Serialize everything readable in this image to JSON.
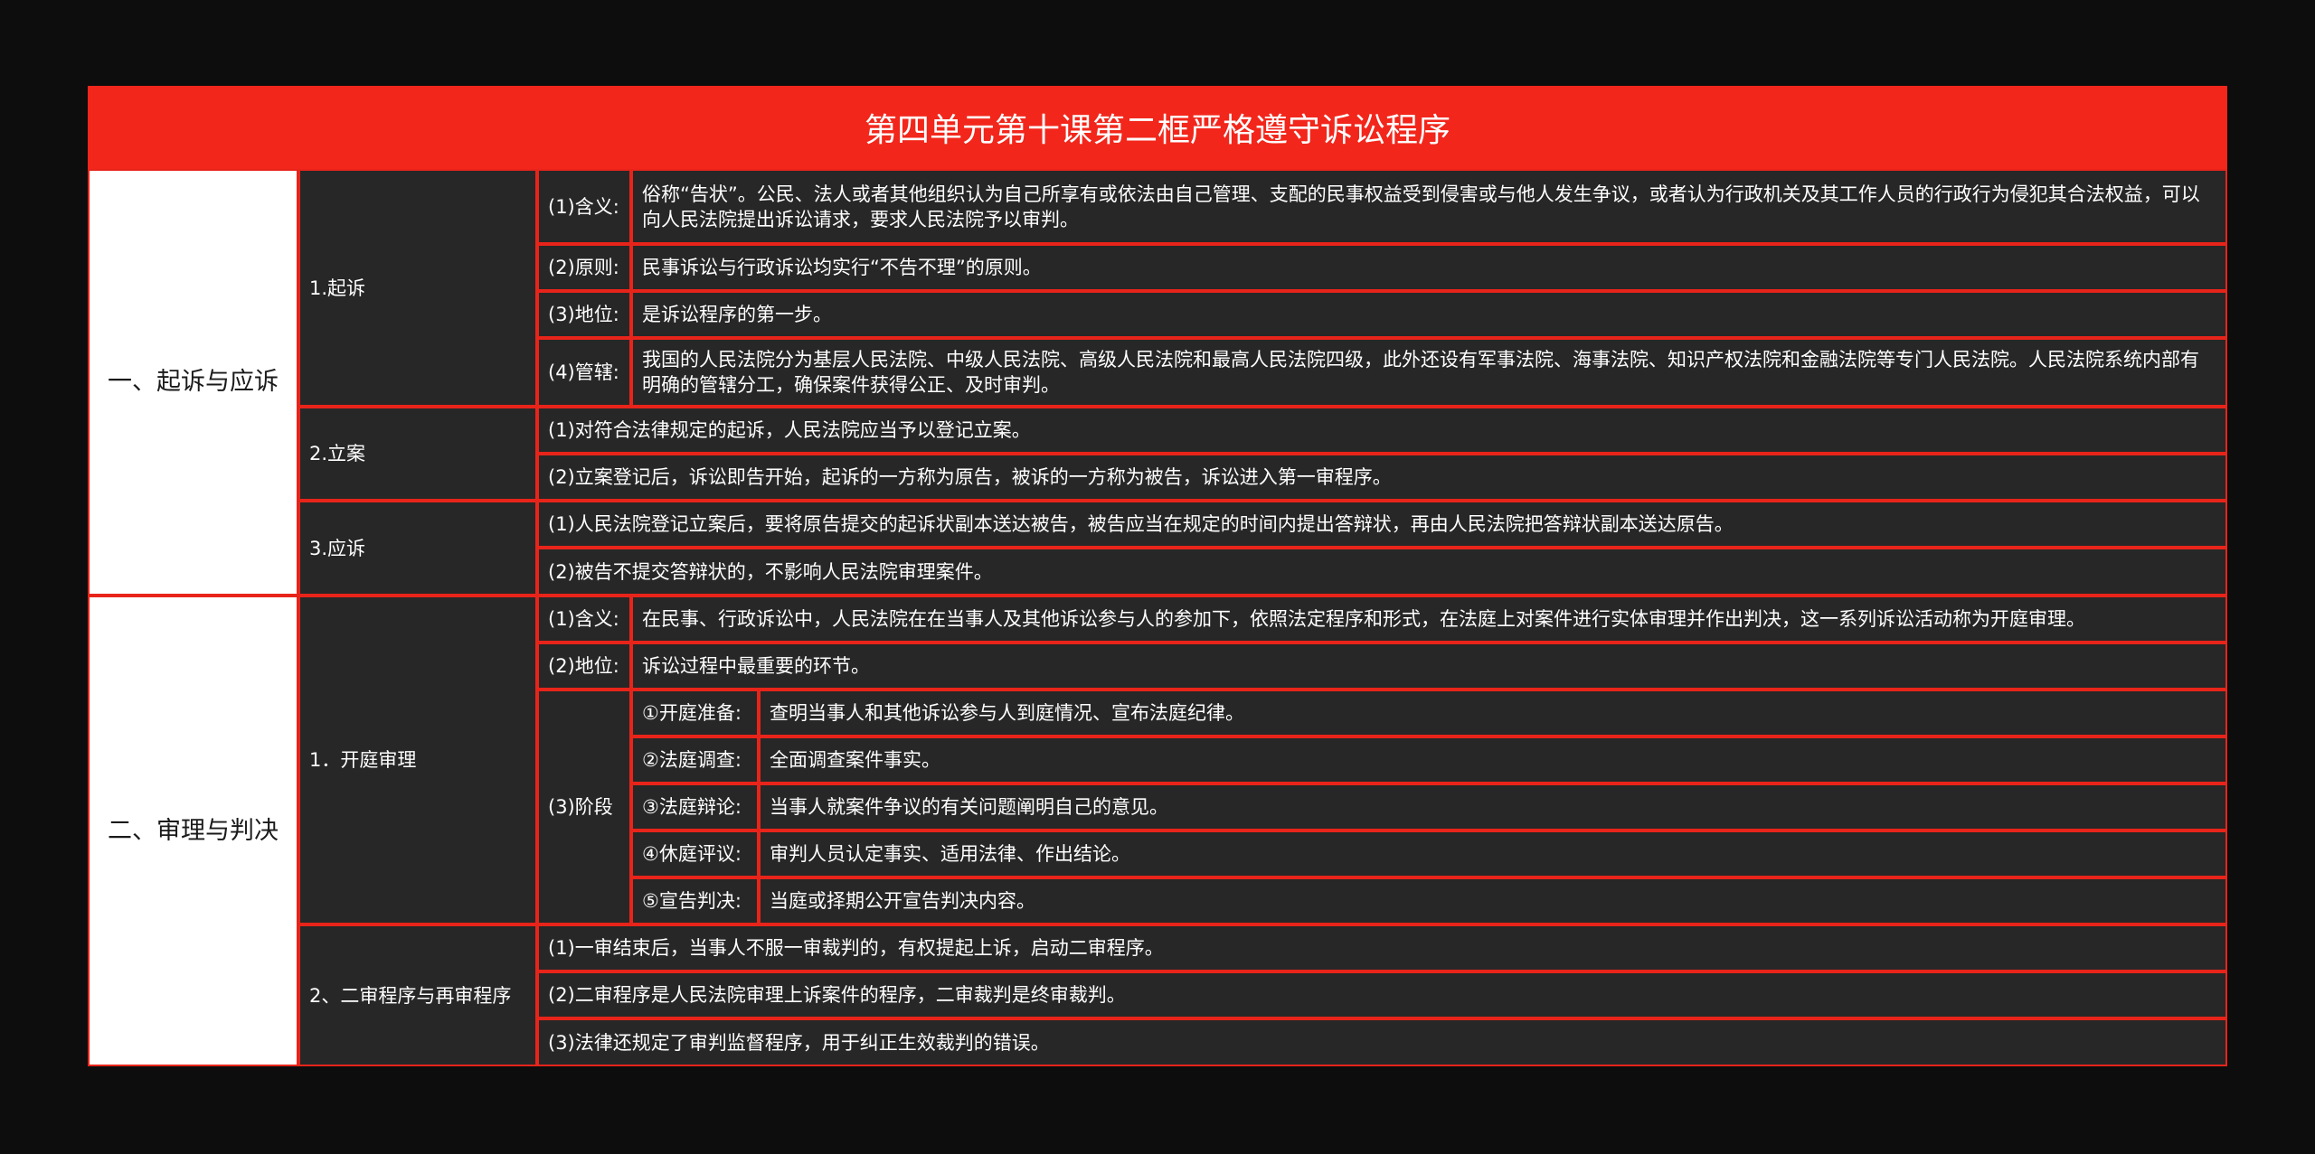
{
  "title": "第四单元第十课第二框严格遵守诉讼程序",
  "sections": [
    {
      "label": "一、起诉与应诉",
      "groups": [
        {
          "label": "1.起诉",
          "items": [
            {
              "key": "(1)含义:",
              "text": "俗称“告状”。公民、法人或者其他组织认为自己所享有或依法由自己管理、支配的民事权益受到侵害或与他人发生争议，或者认为行政机关及其工作人员的行政行为侵犯其合法权益，可以向人民法院提出诉讼请求，要求人民法院予以审判。"
            },
            {
              "key": "(2)原则:",
              "text": "民事诉讼与行政诉讼均实行“不告不理”的原则。"
            },
            {
              "key": "(3)地位:",
              "text": "是诉讼程序的第一步。"
            },
            {
              "key": "(4)管辖:",
              "text": "我国的人民法院分为基层人民法院、中级人民法院、高级人民法院和最高人民法院四级，此外还设有军事法院、海事法院、知识产权法院和金融法院等专门人民法院。人民法院系统内部有明确的管辖分工，确保案件获得公正、及时审判。"
            }
          ]
        },
        {
          "label": "2.立案",
          "items": [
            {
              "text": "(1)对符合法律规定的起诉，人民法院应当予以登记立案。"
            },
            {
              "text": "(2)立案登记后，诉讼即告开始，起诉的一方称为原告，被诉的一方称为被告，诉讼进入第一审程序。"
            }
          ]
        },
        {
          "label": "3.应诉",
          "items": [
            {
              "text": "(1)人民法院登记立案后，要将原告提交的起诉状副本送达被告，被告应当在规定的时间内提出答辩状，再由人民法院把答辩状副本送达原告。"
            },
            {
              "text": "(2)被告不提交答辩状的，不影响人民法院审理案件。"
            }
          ]
        }
      ]
    },
    {
      "label": "二、审理与判决",
      "groups": [
        {
          "label": "1．开庭审理",
          "items": [
            {
              "key": "(1)含义:",
              "text": "在民事、行政诉讼中，人民法院在在当事人及其他诉讼参与人的参加下，依照法定程序和形式，在法庭上对案件进行实体审理并作出判决，这一系列诉讼活动称为开庭审理。"
            },
            {
              "key": "(2)地位:",
              "text": "诉讼过程中最重要的环节。"
            },
            {
              "key": "(3)阶段",
              "stages": [
                {
                  "key": "①开庭准备:",
                  "text": "查明当事人和其他诉讼参与人到庭情况、宣布法庭纪律。"
                },
                {
                  "key": "②法庭调查:",
                  "text": "全面调查案件事实。"
                },
                {
                  "key": "③法庭辩论:",
                  "text": "当事人就案件争议的有关问题阐明自己的意见。"
                },
                {
                  "key": "④休庭评议:",
                  "text": "审判人员认定事实、适用法律、作出结论。"
                },
                {
                  "key": "⑤宣告判决:",
                  "text": "当庭或择期公开宣告判决内容。"
                }
              ]
            }
          ]
        },
        {
          "label": "2、二审程序与再审程序",
          "items": [
            {
              "text": "(1)一审结束后，当事人不服一审裁判的，有权提起上诉，启动二审程序。"
            },
            {
              "text": "(2)二审程序是人民法院审理上诉案件的程序，二审裁判是终审裁判。"
            },
            {
              "text": "(3)法律还规定了审判监督程序，用于纠正生效裁判的错误。"
            }
          ]
        }
      ]
    }
  ],
  "colors": {
    "title_bg": "#f2261b",
    "border": "#e8241a",
    "cell_bg": "#272727",
    "section_bg": "#ffffff",
    "page_bg": "#0d0d0d"
  }
}
